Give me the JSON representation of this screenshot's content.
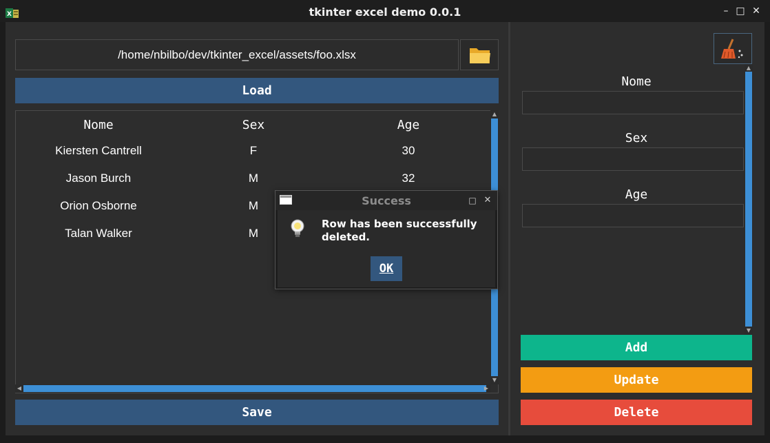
{
  "window": {
    "title": "tkinter excel demo 0.0.1",
    "minimize_glyph": "–",
    "maximize_glyph": "□",
    "close_glyph": "✕"
  },
  "file": {
    "path": "/home/nbilbo/dev/tkinter_excel/assets/foo.xlsx"
  },
  "buttons": {
    "load": "Load",
    "save": "Save",
    "add": "Add",
    "update": "Update",
    "delete": "Delete"
  },
  "table": {
    "columns": [
      "Nome",
      "Sex",
      "Age"
    ],
    "rows": [
      [
        "Kiersten Cantrell",
        "F",
        "30"
      ],
      [
        "Jason Burch",
        "M",
        "32"
      ],
      [
        "Orion Osborne",
        "M",
        ""
      ],
      [
        "Talan Walker",
        "M",
        ""
      ]
    ]
  },
  "form": {
    "nome_label": "Nome",
    "sex_label": "Sex",
    "age_label": "Age",
    "nome_value": "",
    "sex_value": "",
    "age_value": ""
  },
  "dialog": {
    "title": "Success",
    "message": "Row has been successfully deleted.",
    "ok_label": "OK",
    "close_glyph": "✕",
    "maximize_glyph": "□"
  },
  "icons": {
    "app": "excel-app-icon",
    "folder": "folder-icon",
    "clear": "broom-icon",
    "dialog": "lightbulb-icon"
  },
  "colors": {
    "primary_blue": "#33577e",
    "scroll_blue": "#3d8fd6",
    "add_green": "#0db58c",
    "update_orange": "#f39c12",
    "delete_red": "#e74c3c"
  }
}
